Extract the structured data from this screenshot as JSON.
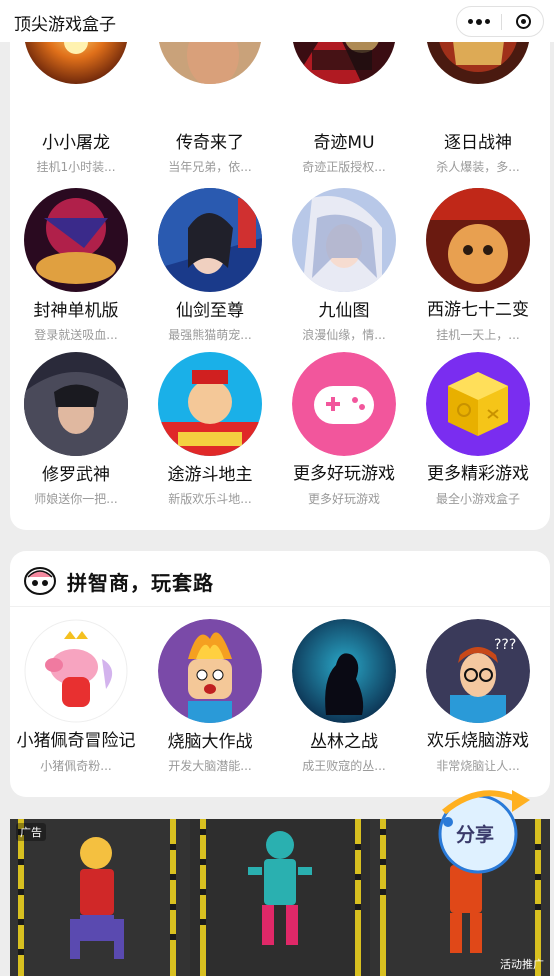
{
  "header": {
    "title": "顶尖游戏盒子"
  },
  "section1": {
    "games": [
      {
        "name": "小小屠龙",
        "desc": "挂机1小时装..."
      },
      {
        "name": "传奇来了",
        "desc": "当年兄弟，依..."
      },
      {
        "name": "奇迹MU",
        "desc": "奇迹正版授权..."
      },
      {
        "name": "逐日战神",
        "desc": "杀人爆装，多..."
      },
      {
        "name": "封神单机版",
        "desc": "登录就送吸血..."
      },
      {
        "name": "仙剑至尊",
        "desc": "最强熊猫萌宠..."
      },
      {
        "name": "九仙图",
        "desc": "浪漫仙缘，情..."
      },
      {
        "name": "西游七十二变",
        "desc": "挂机一天上，..."
      },
      {
        "name": "修罗武神",
        "desc": "师娘送你一把..."
      },
      {
        "name": "途游斗地主",
        "desc": "新版欢乐斗地..."
      },
      {
        "name": "更多好玩游戏",
        "desc": "更多好玩游戏"
      },
      {
        "name": "更多精彩游戏",
        "desc": "最全小游戏盒子"
      }
    ]
  },
  "section2": {
    "title": "拼智商，玩套路",
    "games": [
      {
        "name": "小猪佩奇冒险记",
        "desc": "小猪佩奇粉..."
      },
      {
        "name": "烧脑大作战",
        "desc": "开发大脑潜能..."
      },
      {
        "name": "丛林之战",
        "desc": "成王败寇的丛..."
      },
      {
        "name": "欢乐烧脑游戏",
        "desc": "非常烧脑让人..."
      }
    ]
  },
  "ad": {
    "badge": "广告",
    "promo": "活动推广"
  },
  "share": {
    "label": "分享"
  },
  "icons": {
    "more": "more-dots-icon",
    "close": "close-target-icon",
    "logo": "brain-logo-icon",
    "share": "share-arrow-icon"
  },
  "colors": {
    "background": "#ededed",
    "card": "#ffffff",
    "pink_button": "#f2569c",
    "yellow_cube": "#f5c518",
    "purple_bg": "#7a2df0"
  }
}
